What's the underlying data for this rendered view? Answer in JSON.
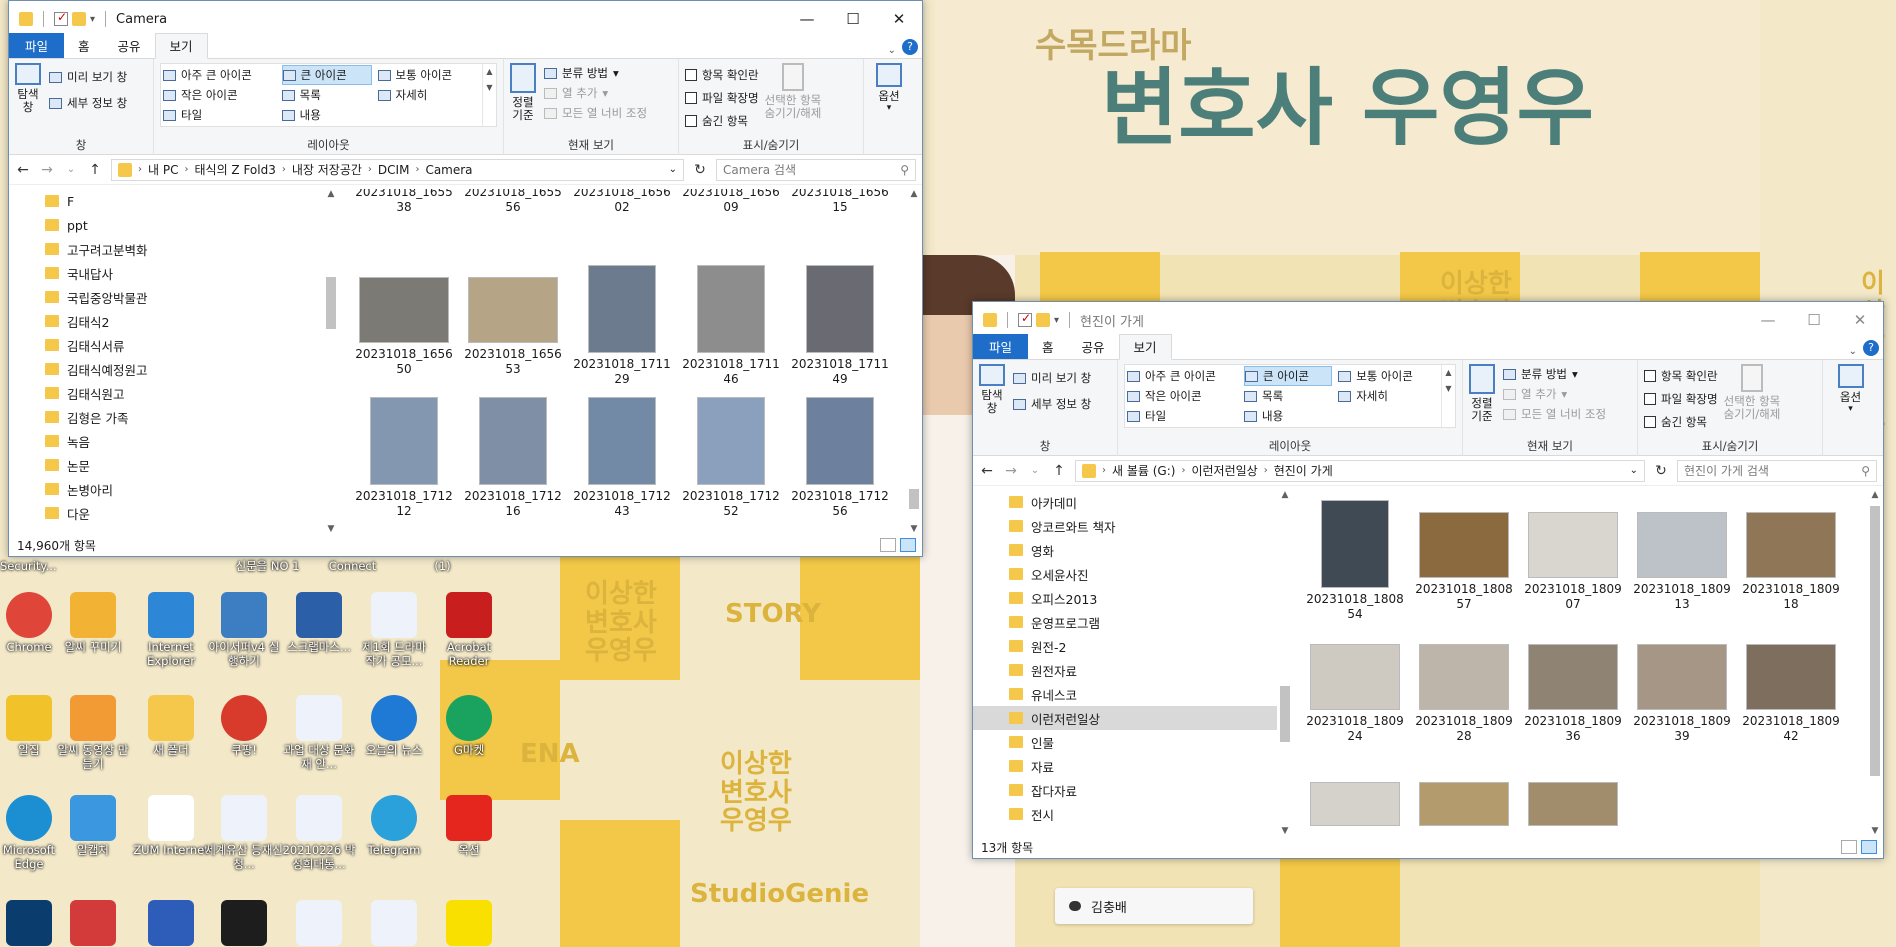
{
  "desktop": {
    "poster_small": "수목드라마",
    "poster_big": "변호사 우영우",
    "watermarks": [
      "이상한\n변호사\n우영우",
      "ENA",
      "STORY",
      "StudioGenie"
    ],
    "top_labels": [
      "Security...",
      "신문을 NO 1",
      "Connect",
      "(1)"
    ],
    "icons": [
      {
        "label": "Chrome",
        "icon": "chrome-icon"
      },
      {
        "label": "알씨 꾸미기",
        "icon": "alsee-decorate-icon"
      },
      {
        "label": "Internet Explorer",
        "icon": "internet-explorer-icon"
      },
      {
        "label": "아이서퍼v4 실행하기",
        "icon": "isurfer-icon"
      },
      {
        "label": "스크랩마스...",
        "icon": "scrapmaster-icon"
      },
      {
        "label": "제1회 드라마 작가 공모...",
        "icon": "hwp-doc-icon"
      },
      {
        "label": "Acrobat Reader",
        "icon": "acrobat-icon"
      },
      {
        "label": "알집",
        "icon": "alzip-icon"
      },
      {
        "label": "알씨 동영상 만들기",
        "icon": "alsee-video-icon"
      },
      {
        "label": "새 폴더",
        "icon": "folder-icon"
      },
      {
        "label": "쿠팡!",
        "icon": "coupang-icon"
      },
      {
        "label": "과업 대상 문화재 안...",
        "icon": "hwp-doc-icon"
      },
      {
        "label": "오늘의 뉴스",
        "icon": "edge-news-icon"
      },
      {
        "label": "G마켓",
        "icon": "gmarket-icon"
      },
      {
        "label": "Microsoft Edge",
        "icon": "edge-icon"
      },
      {
        "label": "알캡처",
        "icon": "alcapture-icon"
      },
      {
        "label": "ZUM Internet",
        "icon": "zum-icon"
      },
      {
        "label": "세계유산 등재신청...",
        "icon": "hwp-doc-icon"
      },
      {
        "label": "20210226 박성희대통...",
        "icon": "hwp-doc-icon"
      },
      {
        "label": "Telegram",
        "icon": "telegram-icon"
      },
      {
        "label": "옥션",
        "icon": "auction-icon"
      },
      {
        "label": "",
        "icon": "photoshop-icon"
      },
      {
        "label": "",
        "icon": "pdf-editor-icon"
      },
      {
        "label": "",
        "icon": "v3-icon"
      },
      {
        "label": "",
        "icon": "app-icon"
      },
      {
        "label": "",
        "icon": "hwp-doc-icon"
      },
      {
        "label": "",
        "icon": "hwp-doc-icon"
      },
      {
        "label": "",
        "icon": "kakaotalk-icon"
      }
    ],
    "chat_name": "김충배",
    "colors": {
      "accent": "#1e6dc9",
      "tile_yellow": "#f3c848",
      "title_teal": "#4c7f7a"
    }
  },
  "ribbon_tabs": [
    "파일",
    "홈",
    "공유",
    "보기"
  ],
  "ribbon": {
    "pane": {
      "navigation": "탐색\n창",
      "preview": "미리 보기 창",
      "details": "세부 정보 창",
      "label": "창"
    },
    "layout": {
      "items": [
        "아주 큰 아이콘",
        "큰 아이콘",
        "보통 아이콘",
        "작은 아이콘",
        "목록",
        "자세히",
        "타일",
        "내용"
      ],
      "selected": "큰 아이콘",
      "label": "레이아웃"
    },
    "current_view": {
      "sort": "정렬\n기준",
      "group": "분류 방법",
      "add_col": "열 추가",
      "fit": "모든 열 너비 조정",
      "label": "현재 보기"
    },
    "show_hide": {
      "checkbox": "항목 확인란",
      "ext": "파일 확장명",
      "hidden": "숨긴 항목",
      "hide_sel": "선택한 항목\n숨기기/해제",
      "label": "표시/숨기기"
    },
    "options": "옵션"
  },
  "win1": {
    "title": "Camera",
    "path": [
      "내 PC",
      "태식의 Z Fold3",
      "내장 저장공간",
      "DCIM",
      "Camera"
    ],
    "search_placeholder": "Camera 검색",
    "tree": [
      "F",
      "ppt",
      "고구려고분벽화",
      "국내답사",
      "국립중앙박물관",
      "김태식2",
      "김태식서류",
      "김태식예정원고",
      "김태식원고",
      "김형은 가족",
      "녹음",
      "논문",
      "논병아리",
      "다운"
    ],
    "files": [
      [
        "20231018_1655\n38",
        "20231018_1655\n56",
        "20231018_1656\n02",
        "20231018_1656\n09",
        "20231018_1656\n15"
      ],
      [
        "20231018_1656\n50",
        "20231018_1656\n53",
        "20231018_1711\n29",
        "20231018_1711\n46",
        "20231018_1711\n49"
      ],
      [
        "20231018_1712\n12",
        "20231018_1712\n16",
        "20231018_1712\n43",
        "20231018_1712\n52",
        "20231018_1712\n56"
      ]
    ],
    "status": "14,960개 항목"
  },
  "win2": {
    "title": "현진이 가게",
    "path": [
      "새 볼륨 (G:)",
      "이런저런일상",
      "현진이 가게"
    ],
    "search_placeholder": "현진이 가게 검색",
    "tree": [
      "아카데미",
      "앙코르와트 책자",
      "영화",
      "오세윤사진",
      "오피스2013",
      "운영프로그램",
      "원전-2",
      "원전자료",
      "유네스코",
      "이런저런일상",
      "인물",
      "자료",
      "잡다자료",
      "전시"
    ],
    "tree_selected": "이런저런일상",
    "files": [
      [
        "20231018_1808\n54",
        "20231018_1808\n57",
        "20231018_1809\n07",
        "20231018_1809\n13",
        "20231018_1809\n18"
      ],
      [
        "20231018_1809\n24",
        "20231018_1809\n28",
        "20231018_1809\n36",
        "20231018_1809\n39",
        "20231018_1809\n42"
      ],
      [
        "",
        "",
        ""
      ]
    ],
    "status": "13개 항목"
  }
}
